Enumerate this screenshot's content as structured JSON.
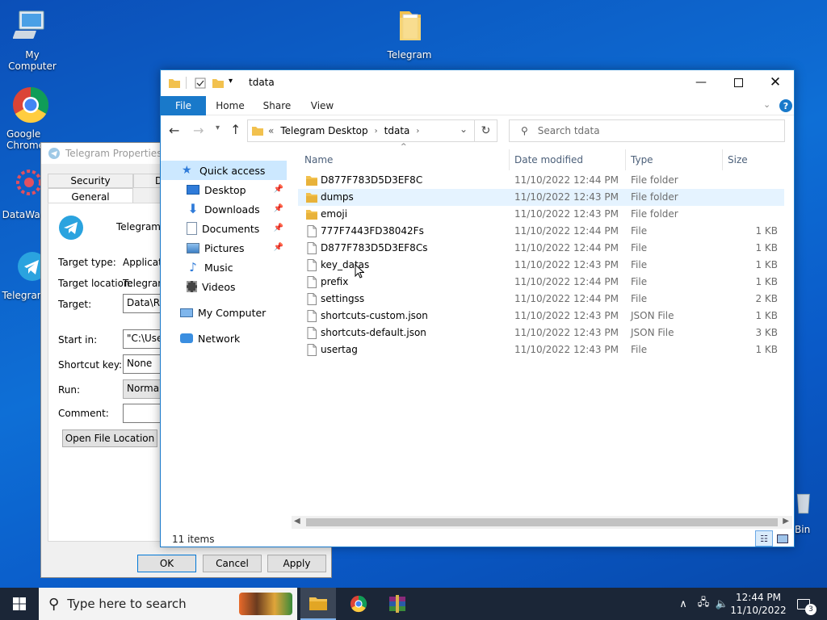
{
  "desktop": {
    "icons": [
      {
        "label": "My Computer"
      },
      {
        "label": "Telegram"
      },
      {
        "label": "Google Chrome"
      },
      {
        "label": "DataWag"
      },
      {
        "label": "Telegram"
      },
      {
        "label": "Bin"
      }
    ]
  },
  "properties": {
    "title": "Telegram Properties",
    "tabs": {
      "security": "Security",
      "details": "Details",
      "general": "General"
    },
    "app_name": "Telegram",
    "fields": {
      "target_type_label": "Target type:",
      "target_type_value": "Application",
      "target_location_label": "Target location:",
      "target_location_value": "Telegram Desktop",
      "target_label": "Target:",
      "target_value": "Data\\Roaming\\Telegram Desktop\\Telegram.exe\"",
      "start_in_label": "Start in:",
      "start_in_value": "\"C:\\Users\\",
      "shortcut_key_label": "Shortcut key:",
      "shortcut_key_value": "None",
      "run_label": "Run:",
      "run_value": "Normal window",
      "comment_label": "Comment:",
      "comment_value": ""
    },
    "open_location_button": "Open File Location",
    "buttons": {
      "ok": "OK",
      "cancel": "Cancel",
      "apply": "Apply"
    }
  },
  "explorer": {
    "title": "tdata",
    "ribbon_tabs": {
      "file": "File",
      "home": "Home",
      "share": "Share",
      "view": "View"
    },
    "breadcrumb": {
      "prefix": "«",
      "parent": "Telegram Desktop",
      "current": "tdata"
    },
    "search_placeholder": "Search tdata",
    "nav": {
      "quick_access": "Quick access",
      "desktop": "Desktop",
      "downloads": "Downloads",
      "documents": "Documents",
      "pictures": "Pictures",
      "music": "Music",
      "videos": "Videos",
      "my_computer": "My Computer",
      "network": "Network"
    },
    "columns": {
      "name": "Name",
      "date": "Date modified",
      "type": "Type",
      "size": "Size"
    },
    "files": [
      {
        "name": "D877F783D5D3EF8C",
        "date": "11/10/2022 12:44 PM",
        "type": "File folder",
        "size": "",
        "kind": "folder"
      },
      {
        "name": "dumps",
        "date": "11/10/2022 12:43 PM",
        "type": "File folder",
        "size": "",
        "kind": "folder"
      },
      {
        "name": "emoji",
        "date": "11/10/2022 12:43 PM",
        "type": "File folder",
        "size": "",
        "kind": "folder"
      },
      {
        "name": "777F7443FD38042Fs",
        "date": "11/10/2022 12:44 PM",
        "type": "File",
        "size": "1 KB",
        "kind": "file"
      },
      {
        "name": "D877F783D5D3EF8Cs",
        "date": "11/10/2022 12:44 PM",
        "type": "File",
        "size": "1 KB",
        "kind": "file"
      },
      {
        "name": "key_datas",
        "date": "11/10/2022 12:43 PM",
        "type": "File",
        "size": "1 KB",
        "kind": "file"
      },
      {
        "name": "prefix",
        "date": "11/10/2022 12:44 PM",
        "type": "File",
        "size": "1 KB",
        "kind": "file"
      },
      {
        "name": "settingss",
        "date": "11/10/2022 12:44 PM",
        "type": "File",
        "size": "2 KB",
        "kind": "file"
      },
      {
        "name": "shortcuts-custom.json",
        "date": "11/10/2022 12:43 PM",
        "type": "JSON File",
        "size": "1 KB",
        "kind": "file"
      },
      {
        "name": "shortcuts-default.json",
        "date": "11/10/2022 12:43 PM",
        "type": "JSON File",
        "size": "3 KB",
        "kind": "file"
      },
      {
        "name": "usertag",
        "date": "11/10/2022 12:43 PM",
        "type": "File",
        "size": "1 KB",
        "kind": "file"
      }
    ],
    "status": "11 items"
  },
  "taskbar": {
    "search_placeholder": "Type here to search",
    "time": "12:44 PM",
    "date": "11/10/2022",
    "notification_count": "3"
  },
  "colors": {
    "accent": "#1979ca",
    "folder": "#f2c14e",
    "taskbar": "#1b2637"
  },
  "icons": [
    "windows-icon",
    "search-icon",
    "folder-icon",
    "file-icon",
    "chrome-icon",
    "winrar-icon",
    "star-icon",
    "refresh-icon",
    "chevron-down-icon",
    "up-arrow-icon",
    "back-arrow-icon",
    "forward-arrow-icon",
    "help-icon",
    "pin-icon",
    "network-icon",
    "volume-icon",
    "notification-icon",
    "details-view-icon",
    "large-icons-view-icon"
  ]
}
